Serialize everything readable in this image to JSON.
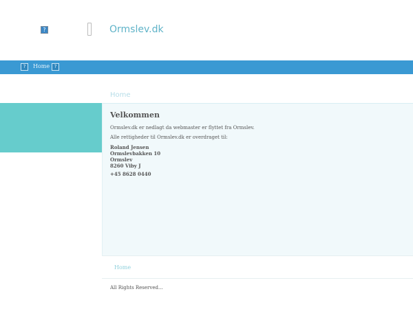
{
  "header": {
    "logo_icon": "broken-image-icon",
    "logo_glyph": "?",
    "divider_icon": "missing-glyph-icon",
    "site_title": "Ormslev.dk"
  },
  "nav": {
    "left_icon": "broken-image-icon",
    "right_icon": "broken-image-icon",
    "icon_glyph": "?",
    "home_label": "Home",
    "bar_color": "#3a99d3"
  },
  "breadcrumb": {
    "label": "Home"
  },
  "content": {
    "title": "Velkommen",
    "paragraph_1": "Ormslev.dk er nedlagt da webmaster er flyttet fra Ormslev.",
    "paragraph_2": "Alle rettigheder til Ormslev.dk er overdraget til:",
    "address": {
      "name": "Roland Jensen",
      "street": "Ormslevbakken 10",
      "town": "Ormslev",
      "postal": "8260 Viby J"
    },
    "phone": "+45 8628 0440"
  },
  "colors": {
    "accent_teal": "#66cccc",
    "content_background": "#f1f9fb",
    "title_color": "#5fb3c8"
  },
  "footer": {
    "home_link": "Home",
    "copyright": "All Rights Reserved..."
  }
}
